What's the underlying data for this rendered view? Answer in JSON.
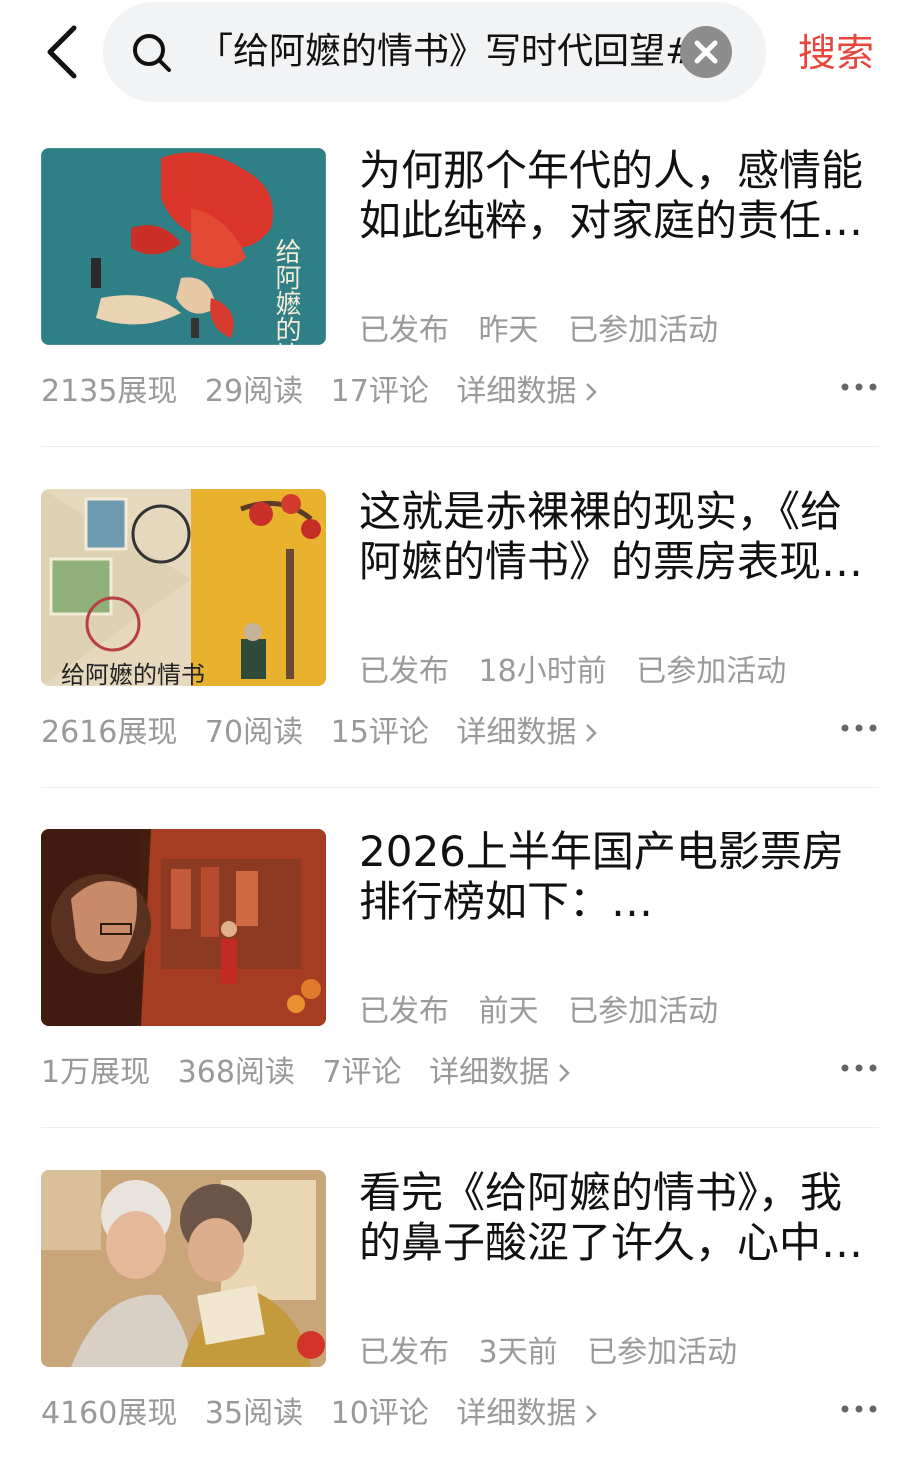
{
  "search": {
    "query": "「给阿嬷的情书》写时代回望#",
    "button_label": "搜索"
  },
  "items": [
    {
      "title": "为何那个年代的人，感情能如此纯粹，对家庭的责任…",
      "status": "已发布",
      "time": "昨天",
      "activity": "已参加活动",
      "views": "2135展现",
      "reads": "29阅读",
      "comments": "17评论",
      "detail": "详细数据",
      "thumb_text": "给阿嬷的情"
    },
    {
      "title": "这就是赤裸裸的现实，《给阿嬷的情书》的票房表现…",
      "status": "已发布",
      "time": "18小时前",
      "activity": "已参加活动",
      "views": "2616展现",
      "reads": "70阅读",
      "comments": "15评论",
      "detail": "详细数据",
      "thumb_text": "给阿嬷的情书"
    },
    {
      "title": "2026上半年国产电影票房排行榜如下：…",
      "status": "已发布",
      "time": "前天",
      "activity": "已参加活动",
      "views": "1万展现",
      "reads": "368阅读",
      "comments": "7评论",
      "detail": "详细数据",
      "thumb_text": ""
    },
    {
      "title": "看完《给阿嬷的情书》，我的鼻子酸涩了许久，心中…",
      "status": "已发布",
      "time": "3天前",
      "activity": "已参加活动",
      "views": "4160展现",
      "reads": "35阅读",
      "comments": "10评论",
      "detail": "详细数据",
      "thumb_text": ""
    }
  ],
  "colors": {
    "accent": "#e8453c",
    "meta": "#9a9a9a"
  }
}
